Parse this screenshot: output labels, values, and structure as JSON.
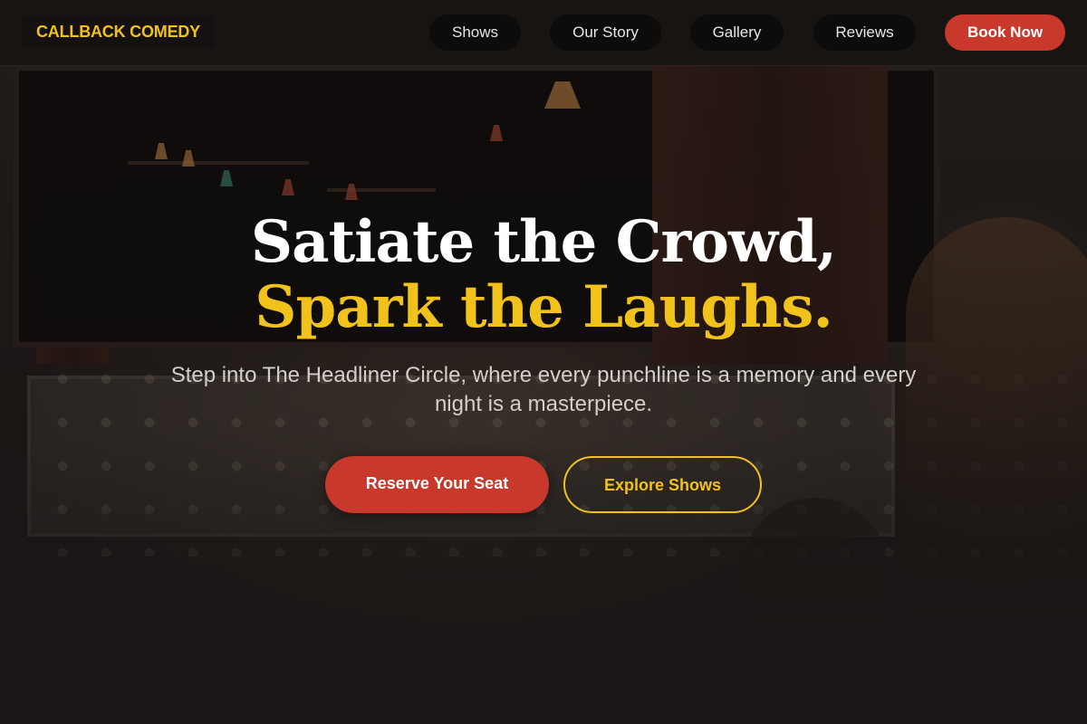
{
  "header": {
    "logo": "CALLBACK COMEDY",
    "nav": [
      {
        "label": "Shows"
      },
      {
        "label": "Our Story"
      },
      {
        "label": "Gallery"
      },
      {
        "label": "Reviews"
      }
    ],
    "cta": "Book Now"
  },
  "hero": {
    "title_line1": "Satiate the Crowd,",
    "title_line2": "Spark the Laughs.",
    "subtitle": "Step into The Headliner Circle, where every punchline is a memory and every night is a masterpiece.",
    "primary_button": "Reserve Your Seat",
    "secondary_button": "Explore Shows",
    "background_image": "comedy-club-marquee-photo"
  },
  "colors": {
    "accent_yellow": "#f1c21b",
    "accent_red": "#c8392c",
    "background": "#1a1716"
  }
}
